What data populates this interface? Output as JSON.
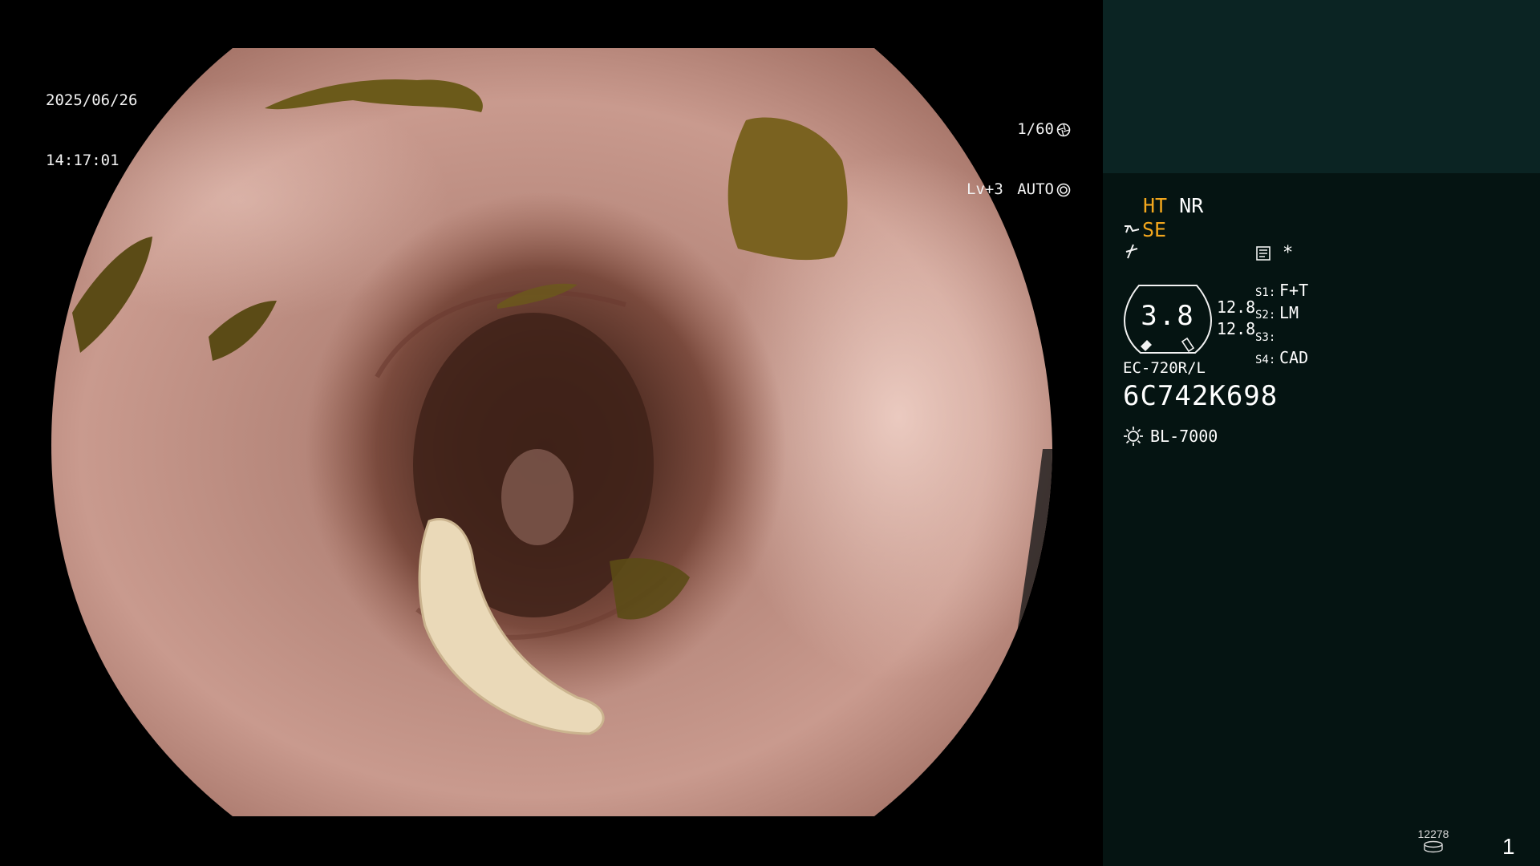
{
  "overlay": {
    "date": "2025/06/26",
    "time": "14:17:01",
    "shutter": "1/60",
    "level": "Lv+3",
    "mode": "AUTO"
  },
  "panel": {
    "ht": "HT",
    "nr": "NR",
    "se": "SE",
    "star": "*",
    "gauge_value": "3.8",
    "gauge_side": [
      "12.8",
      "12.8"
    ],
    "switches": [
      {
        "key": "S1:",
        "value": "F+T"
      },
      {
        "key": "S2:",
        "value": "LM"
      },
      {
        "key": "S3:",
        "value": ""
      },
      {
        "key": "S4:",
        "value": "CAD"
      }
    ],
    "scope_model": "EC-720R/L",
    "scope_serial": "6C742K698",
    "light_source": "BL-7000",
    "counter": "12278",
    "page": "1"
  },
  "colors": {
    "panel_bg": "#051412",
    "panel_top_bg": "#0b2423",
    "accent_orange": "#f3a71d",
    "text": "#f2f2f2"
  },
  "icons": [
    "aperture-icon",
    "iris-icon",
    "scope-icon",
    "stroke-icon",
    "memo-icon",
    "light-icon",
    "disk-icon"
  ]
}
